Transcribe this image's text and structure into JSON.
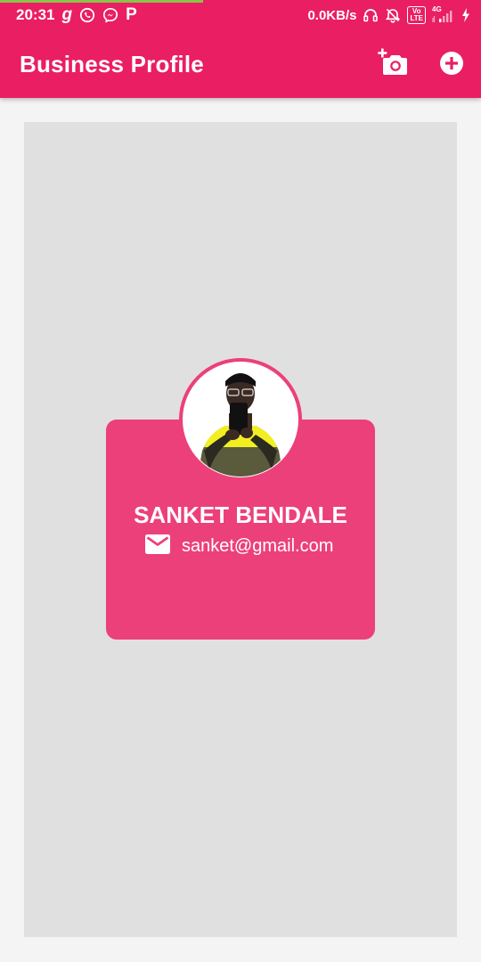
{
  "status_bar": {
    "time": "20:31",
    "net_speed": "0.0KB/s",
    "network_type": "4G",
    "volte_line1": "Vo",
    "volte_line2": "LTE",
    "left_icons": [
      "g-app-icon",
      "whatsapp-icon",
      "messenger-icon",
      "paytm-icon"
    ],
    "right_icons": [
      "headset-icon",
      "alarm-off-icon",
      "volte-icon",
      "signal-icon",
      "charging-icon"
    ]
  },
  "app_bar": {
    "title": "Business Profile",
    "color": "#ea1e63",
    "actions": [
      "add-photo-icon",
      "add-circle-icon"
    ]
  },
  "profile_card": {
    "name": "SANKET BENDALE",
    "email": "sanket@gmail.com",
    "card_color": "#ec407a",
    "canvas_color": "#e0e0e0"
  }
}
